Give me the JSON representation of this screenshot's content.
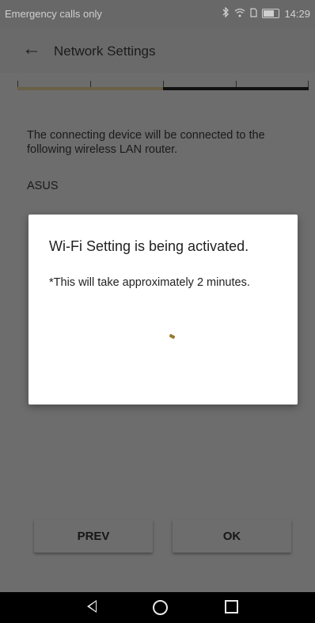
{
  "status_bar": {
    "carrier_text": "Emergency calls only",
    "time": "14:29",
    "icons": [
      "bluetooth-icon",
      "wifi-icon",
      "sim-icon",
      "battery-icon"
    ]
  },
  "app_bar": {
    "title": "Network Settings"
  },
  "progress": {
    "fraction": 0.5,
    "fill_color": "#6a6045",
    "track_color": "#101010"
  },
  "main": {
    "description": "The connecting device will be connected to the following wireless LAN router.",
    "router_name": "ASUS"
  },
  "dialog": {
    "heading": "Wi-Fi Setting is being activated.",
    "note": "*This will take approximately 2 minutes."
  },
  "buttons": {
    "prev_label": "PREV",
    "ok_label": "OK"
  },
  "nav_bar": {
    "icons": [
      "back-triangle-icon",
      "home-circle-icon",
      "recent-square-icon"
    ]
  }
}
